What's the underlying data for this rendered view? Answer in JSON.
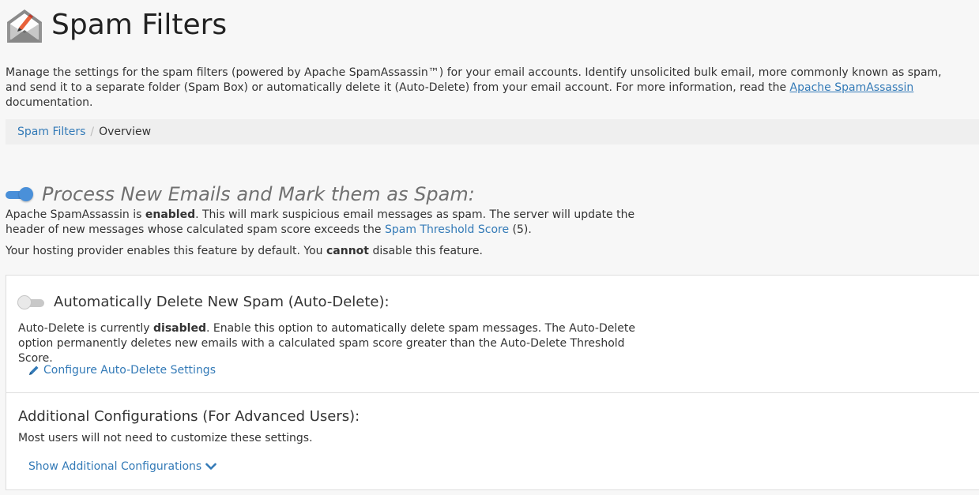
{
  "header": {
    "title": "Spam Filters",
    "icon": "envelope-pencil-icon"
  },
  "intro": {
    "text_before": "Manage the settings for the spam filters (powered by Apache SpamAssassin™) for your email accounts. Identify unsolicited bulk email, more commonly known as spam, and send it to a separate folder (Spam Box) or automatically delete it (Auto-Delete) from your email account. For more information, read the ",
    "link": "Apache SpamAssassin",
    "text_after": " documentation."
  },
  "breadcrumb": {
    "root": "Spam Filters",
    "separator": "/",
    "current": "Overview"
  },
  "process": {
    "toggle_state": "on",
    "title": "Process New Emails and Mark them as Spam:",
    "desc_pre": "Apache SpamAssassin is ",
    "desc_bold": "enabled",
    "desc_mid": ". This will mark suspicious email messages as spam. The server will update the header of new messages whose calculated spam score exceeds the ",
    "desc_link": "Spam Threshold Score",
    "desc_post": " (5).",
    "note_pre": "Your hosting provider enables this feature by default. You ",
    "note_bold": "cannot",
    "note_post": " disable this feature."
  },
  "auto_delete": {
    "toggle_state": "off",
    "title": "Automatically Delete New Spam (Auto-Delete):",
    "desc_pre": "Auto-Delete is currently ",
    "desc_bold": "disabled",
    "desc_post": ". Enable this option to automatically delete spam messages. The Auto-Delete option permanently deletes new emails with a calculated spam score greater than the Auto-Delete Threshold Score.",
    "link": "Configure Auto-Delete Settings"
  },
  "additional": {
    "title": "Additional Configurations (For Advanced Users):",
    "desc": "Most users will not need to customize these settings.",
    "link": "Show Additional Configurations"
  },
  "colors": {
    "accent": "#337ab7",
    "toggle_on": "#4a90d9"
  }
}
